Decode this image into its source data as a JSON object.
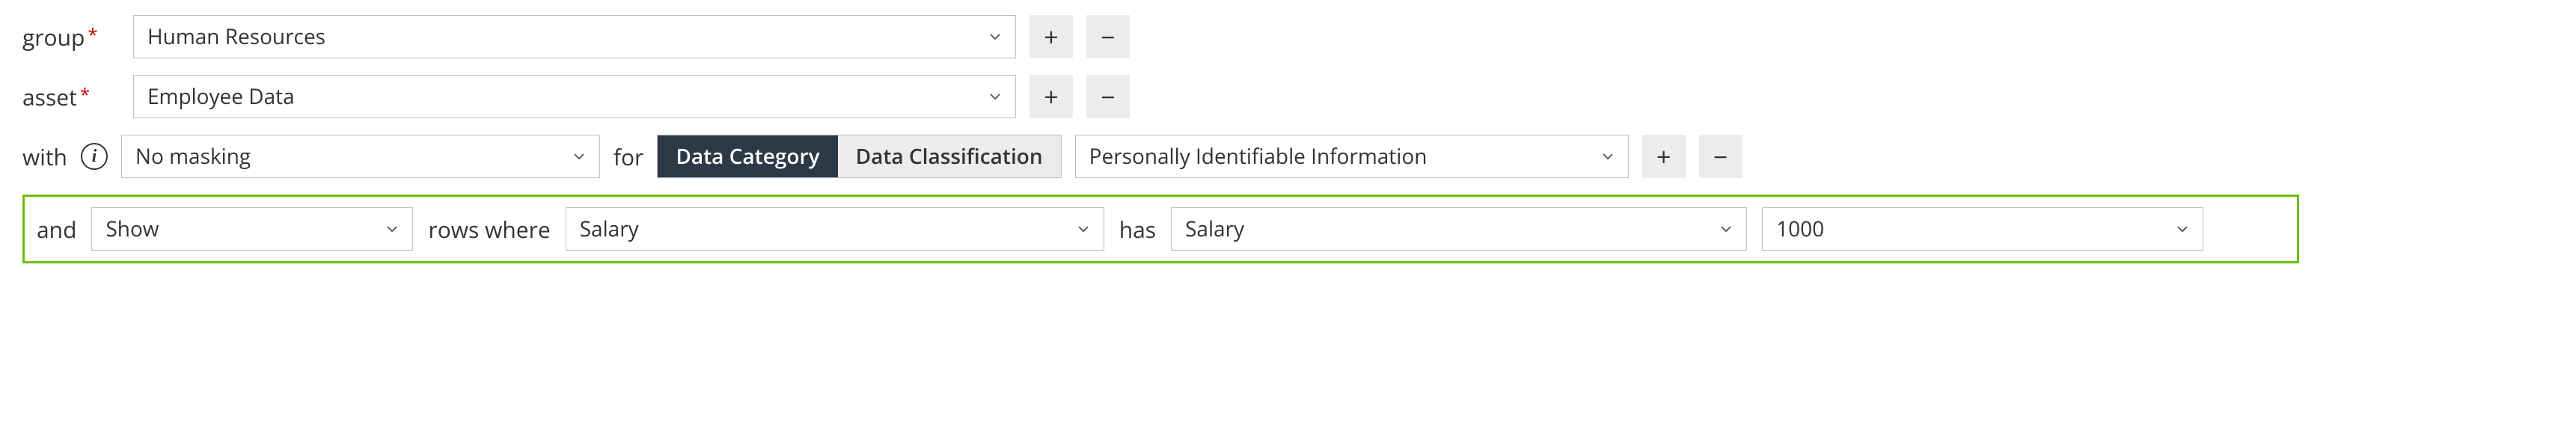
{
  "row1": {
    "label": "group",
    "required_marker": "*",
    "value": "Human Resources"
  },
  "row2": {
    "label": "asset",
    "required_marker": "*",
    "value": "Employee Data"
  },
  "row3": {
    "with_label": "with",
    "masking_value": "No masking",
    "for_label": "for",
    "seg_active": "Data Category",
    "seg_inactive": "Data Classification",
    "category_value": "Personally Identifiable Information"
  },
  "row4": {
    "and_label": "and",
    "show_value": "Show",
    "rows_where_label": "rows where",
    "column_value": "Salary",
    "has_label": "has",
    "operator_value": "Salary",
    "filter_value": "1000"
  },
  "icons": {
    "plus": "+",
    "minus": "−",
    "info": "i"
  }
}
